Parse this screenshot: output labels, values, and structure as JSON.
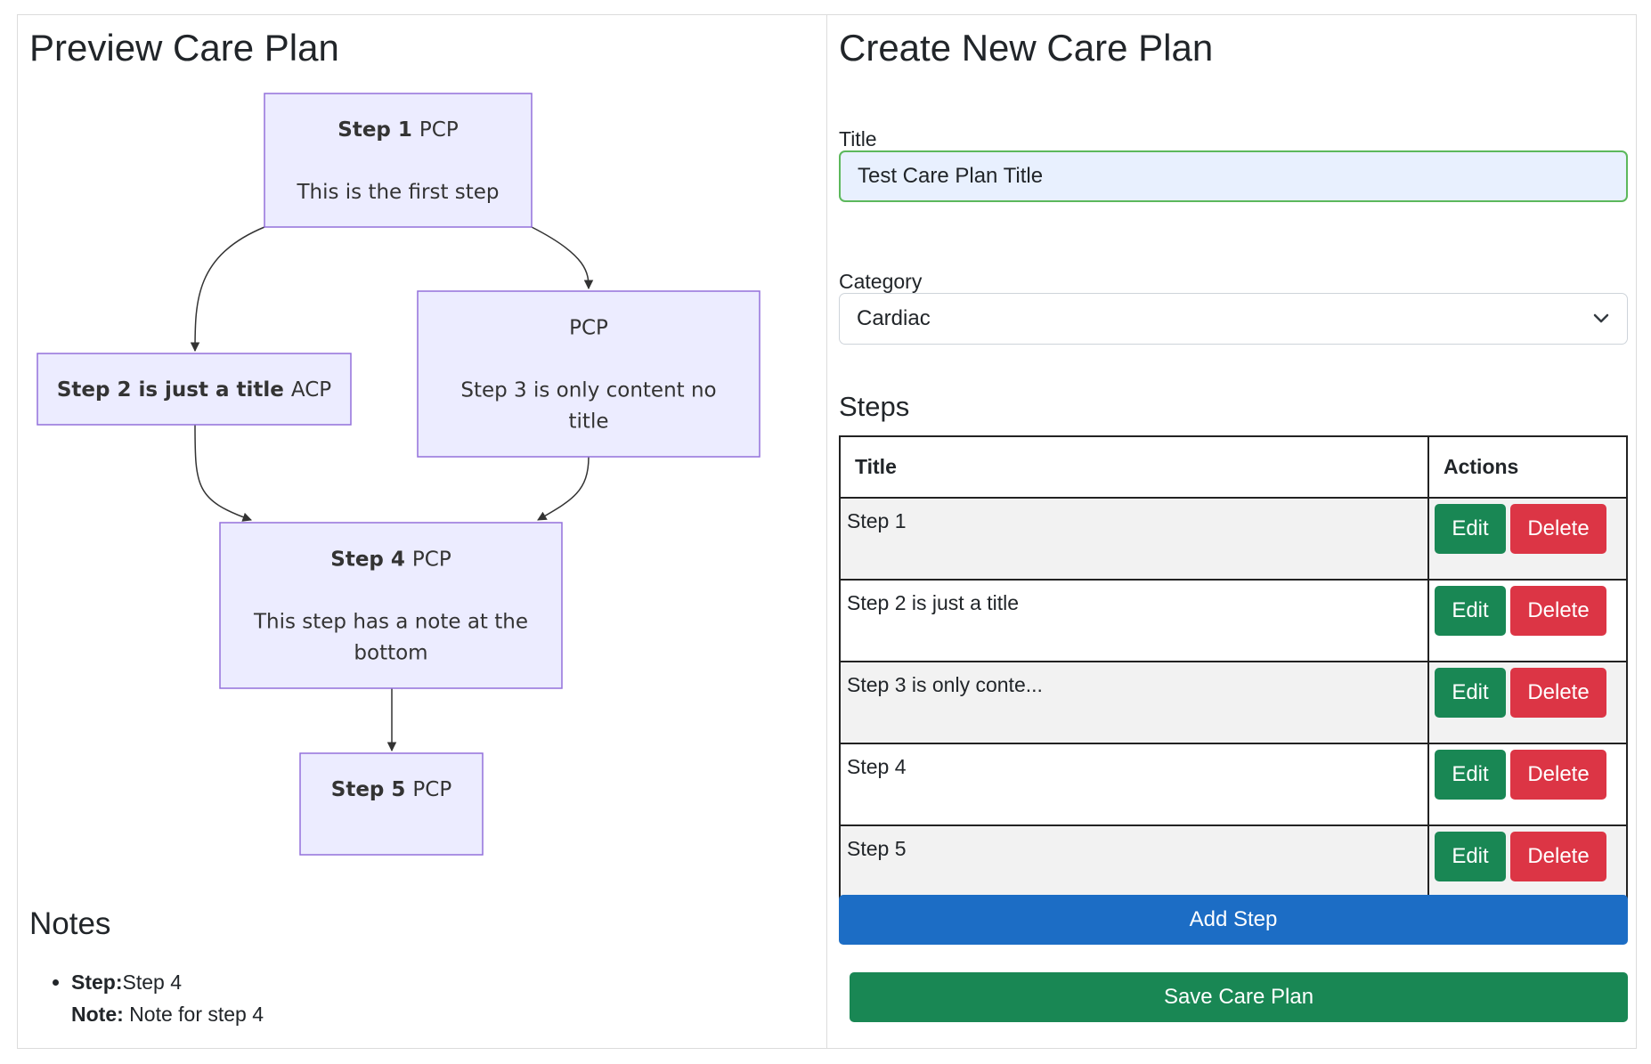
{
  "preview": {
    "title": "Preview Care Plan",
    "flowchart": {
      "nodes": [
        {
          "id": "n1",
          "bold": "Step 1",
          "tag": "PCP",
          "body": [
            "This is the first step"
          ]
        },
        {
          "id": "n2",
          "bold": "Step 2 is just a title",
          "tag": "ACP",
          "body": []
        },
        {
          "id": "n3",
          "bold": "",
          "tag": "PCP",
          "body": [
            "Step 3 is only content no",
            "title"
          ]
        },
        {
          "id": "n4",
          "bold": "Step 4",
          "tag": "PCP",
          "body": [
            "This step has a note at the",
            "bottom"
          ]
        },
        {
          "id": "n5",
          "bold": "Step 5",
          "tag": "PCP",
          "body": []
        }
      ],
      "edges": [
        [
          "n1",
          "n2"
        ],
        [
          "n1",
          "n3"
        ],
        [
          "n2",
          "n4"
        ],
        [
          "n3",
          "n4"
        ],
        [
          "n4",
          "n5"
        ]
      ]
    },
    "notes": {
      "title": "Notes",
      "items": [
        {
          "step_label": "Step:",
          "step_value": "Step 4",
          "note_label": "Note:",
          "note_value": "Note for step 4"
        }
      ]
    }
  },
  "form": {
    "title": "Create New Care Plan",
    "title_label": "Title",
    "title_value": "Test Care Plan Title",
    "category_label": "Category",
    "category_value": "Cardiac",
    "steps_title": "Steps",
    "table": {
      "headers": [
        "Title",
        "Actions"
      ],
      "rows": [
        {
          "title": "Step 1"
        },
        {
          "title": "Step 2 is just a title"
        },
        {
          "title": "Step 3 is only conte..."
        },
        {
          "title": "Step 4"
        },
        {
          "title": "Step 5"
        }
      ],
      "edit_label": "Edit",
      "delete_label": "Delete"
    },
    "add_step_label": "Add Step",
    "save_label": "Save Care Plan"
  },
  "colors": {
    "node_fill": "#ececff",
    "node_stroke": "#9370db",
    "primary": "#1c6dc5",
    "success": "#198754",
    "danger": "#dc3545",
    "valid_border": "#5cb85c"
  },
  "icons": {
    "select_arrow": "chevron-down-icon"
  }
}
